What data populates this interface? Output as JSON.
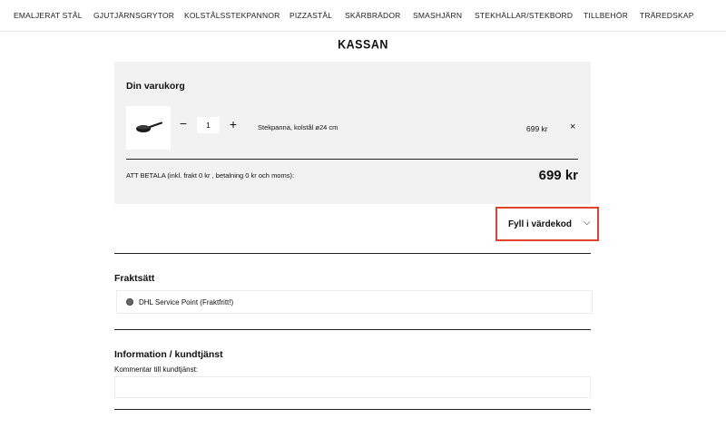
{
  "nav": {
    "items": [
      "EMALJERAT STÅL",
      "GJUTJÄRNSGRYTOR",
      "KOLSTÅLSSTEKPANNOR",
      "PIZZASTÅL",
      "SKÄRBRÄDOR",
      "SMASHJÄRN",
      "STEKHÄLLAR/STEKBORD",
      "TILLBEHÖR",
      "TRÄREDSKAP"
    ]
  },
  "page": {
    "title": "KASSAN"
  },
  "cart": {
    "title": "Din varukorg",
    "item": {
      "thumbnail_icon": "frying-pan-icon",
      "quantity": "1",
      "minus": "−",
      "plus": "+",
      "name": "Stekpanna, kolstål ø24 cm",
      "price": "699 kr",
      "remove": "×"
    },
    "total_label": "ATT BETALA (inkl. frakt 0 kr , betalning 0 kr och moms):",
    "total_amount": "699 kr"
  },
  "voucher": {
    "label": "Fyll i värdekod",
    "chevron": "⌵",
    "highlight_color": "#e0452b"
  },
  "shipping": {
    "title": "Fraktsätt",
    "option": "DHL Service Point (Fraktfritt!)"
  },
  "info": {
    "title": "Information / kundtjänst",
    "comment_label": "Kommentar till kundtjänst:",
    "comment_value": ""
  }
}
